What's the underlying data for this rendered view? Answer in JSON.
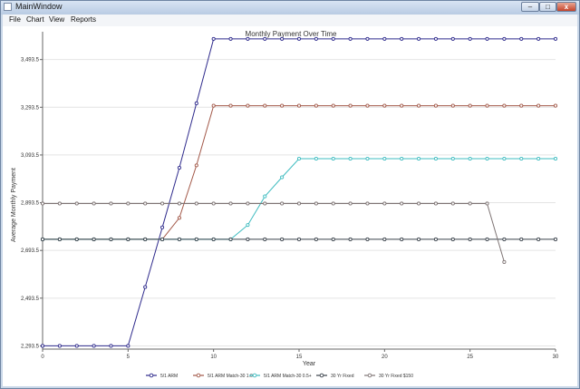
{
  "window": {
    "title": "MainWindow",
    "minimize": "–",
    "maximize": "□",
    "close": "x"
  },
  "menu": [
    {
      "label": "File"
    },
    {
      "label": "Chart"
    },
    {
      "label": "View"
    },
    {
      "label": "Reports"
    }
  ],
  "colors": {
    "arm": "#2e2a8c",
    "arm_1": "#a25848",
    "arm_05": "#3fbcc0",
    "fixed": "#39414a",
    "fixed_150": "#7e7474"
  },
  "chart_data": {
    "type": "line",
    "title": "Monthly Payment Over Time",
    "xlabel": "Year",
    "ylabel": "Average Monthly Payment",
    "xlim": [
      0,
      30
    ],
    "ylim": [
      2280,
      3610
    ],
    "xticks": [
      0,
      5,
      10,
      15,
      20,
      25,
      30
    ],
    "yticks": [
      2293.5,
      2493.5,
      2693.5,
      2893.5,
      3093.5,
      3293.5,
      3493.5
    ],
    "ytick_labels": [
      "2,293.5",
      "2,493.5",
      "2,693.5",
      "2,893.5",
      "3,093.5",
      "3,293.5",
      "3,493.5"
    ],
    "grid": "horizontal",
    "legend_position": "bottom",
    "x": [
      0,
      1,
      2,
      3,
      4,
      5,
      6,
      7,
      8,
      9,
      10,
      11,
      12,
      13,
      14,
      15,
      16,
      17,
      18,
      19,
      20,
      21,
      22,
      23,
      24,
      25,
      26,
      27,
      28,
      29,
      30
    ],
    "series": [
      {
        "name": "5/1 ARM",
        "color_key": "arm",
        "values": [
          2293.5,
          2293.5,
          2293.5,
          2293.5,
          2293.5,
          2293.5,
          2540,
          2790,
          3040,
          3310,
          3580,
          3580,
          3580,
          3580,
          3580,
          3580,
          3580,
          3580,
          3580,
          3580,
          3580,
          3580,
          3580,
          3580,
          3580,
          3580,
          3580,
          3580,
          3580,
          3580,
          3580
        ]
      },
      {
        "name": "5/1 ARM Match-30 1.0+",
        "color_key": "arm_1",
        "values": [
          2740,
          2740,
          2740,
          2740,
          2740,
          2740,
          2740,
          2740,
          2830,
          3050,
          3300,
          3300,
          3300,
          3300,
          3300,
          3300,
          3300,
          3300,
          3300,
          3300,
          3300,
          3300,
          3300,
          3300,
          3300,
          3300,
          3300,
          3300,
          3300,
          3300,
          3300
        ]
      },
      {
        "name": "5/1 ARM Match-30 0.5+",
        "color_key": "arm_05",
        "values": [
          2740,
          2740,
          2740,
          2740,
          2740,
          2740,
          2740,
          2740,
          2740,
          2740,
          2740,
          2740,
          2800,
          2920,
          3000,
          3078,
          3078,
          3078,
          3078,
          3078,
          3078,
          3078,
          3078,
          3078,
          3078,
          3078,
          3078,
          3078,
          3078,
          3078,
          3078
        ]
      },
      {
        "name": "30 Yr Fixed",
        "color_key": "fixed",
        "values": [
          2740,
          2740,
          2740,
          2740,
          2740,
          2740,
          2740,
          2740,
          2740,
          2740,
          2740,
          2740,
          2740,
          2740,
          2740,
          2740,
          2740,
          2740,
          2740,
          2740,
          2740,
          2740,
          2740,
          2740,
          2740,
          2740,
          2740,
          2740,
          2740,
          2740,
          2740
        ]
      },
      {
        "name": "30 Yr Fixed $150",
        "color_key": "fixed_150",
        "values": [
          2890,
          2890,
          2890,
          2890,
          2890,
          2890,
          2890,
          2890,
          2890,
          2890,
          2890,
          2890,
          2890,
          2890,
          2890,
          2890,
          2890,
          2890,
          2890,
          2890,
          2890,
          2890,
          2890,
          2890,
          2890,
          2890,
          2890,
          2645
        ]
      }
    ]
  }
}
